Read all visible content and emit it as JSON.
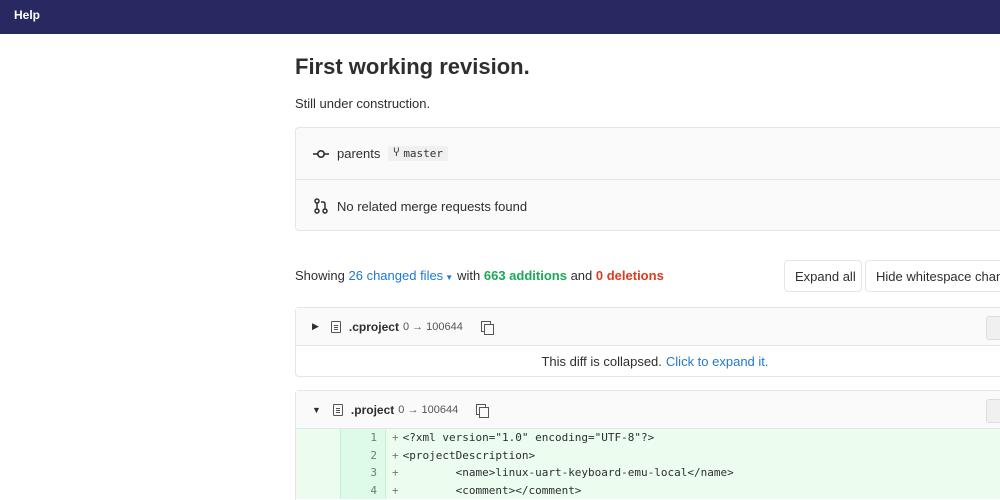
{
  "topbar": {
    "help_label": "Help"
  },
  "commit": {
    "title": "First working revision.",
    "description": "Still under construction.",
    "parents_label": "parents",
    "parent_branch": "master",
    "merge_requests_text": "No related merge requests found"
  },
  "stats": {
    "showing": "Showing",
    "changed_files": "26 changed files",
    "with": "with",
    "additions": "663 additions",
    "and": "and",
    "deletions": "0 deletions"
  },
  "buttons": {
    "expand_all": "Expand all",
    "hide_whitespace": "Hide whitespace changes"
  },
  "files": [
    {
      "name": ".cproject",
      "mode": "0 → 100644",
      "collapsed_text": "This diff is collapsed.",
      "expand_link": "Click to expand it."
    },
    {
      "name": ".project",
      "mode": "0 → 100644",
      "lines": [
        {
          "num": "1",
          "text": "<?xml version=\"1.0\" encoding=\"UTF-8\"?>"
        },
        {
          "num": "2",
          "text": "<projectDescription>"
        },
        {
          "num": "3",
          "text": "        <name>linux-uart-keyboard-emu-local</name>"
        },
        {
          "num": "4",
          "text": "        <comment></comment>"
        }
      ]
    }
  ],
  "icons": {
    "commit": "commit-icon",
    "merge_request": "merge-request-icon",
    "branch": "branch-icon",
    "file": "file-icon",
    "copy": "copy-icon",
    "caret": "caret-down-icon"
  },
  "colors": {
    "topbar": "#292961",
    "link": "#1f78d1",
    "additions": "#1aaa55",
    "deletions": "#db3b21",
    "added_line_bg": "#ecfdf0"
  }
}
